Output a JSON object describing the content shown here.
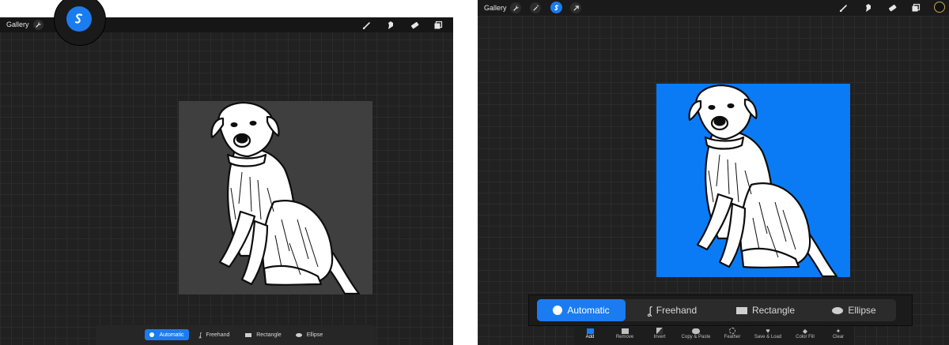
{
  "left": {
    "gallery_label": "Gallery",
    "selection_modes": [
      "Automatic",
      "Freehand",
      "Rectangle",
      "Ellipse"
    ],
    "active_mode": "Automatic"
  },
  "right": {
    "gallery_label": "Gallery",
    "selection_modes": [
      "Automatic",
      "Freehand",
      "Rectangle",
      "Ellipse"
    ],
    "active_mode": "Automatic",
    "bottom_tools": [
      "Add",
      "Remove",
      "Invert",
      "Copy & Paste",
      "Feather",
      "Save & Load",
      "Color Fill",
      "Clear"
    ]
  },
  "colors": {
    "accent": "#1a7cf0",
    "selection_fill": "#0a7bf5",
    "canvas": "#212121",
    "toolbar": "#161616"
  },
  "icons": [
    "wrench-icon",
    "magic-wand-icon",
    "selection-icon",
    "move-arrow-icon",
    "brush-icon",
    "smudge-icon",
    "eraser-icon",
    "layers-icon",
    "color-swatch-icon"
  ]
}
